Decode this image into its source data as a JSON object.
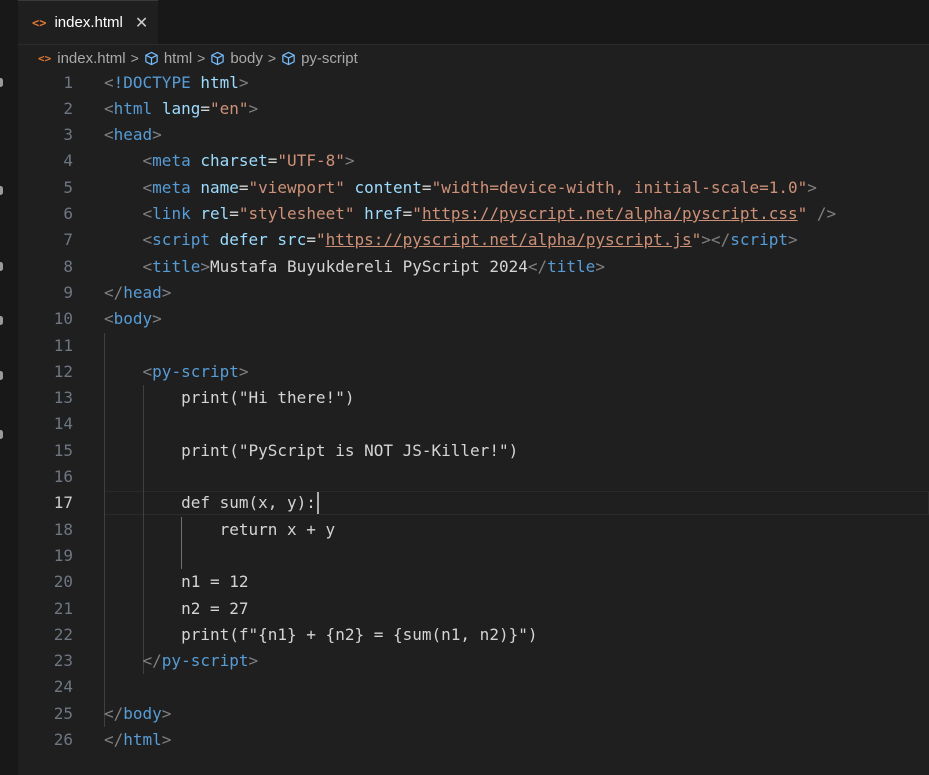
{
  "tab": {
    "icon": "<>",
    "label": "index.html",
    "close": "✕"
  },
  "breadcrumb": {
    "items": [
      {
        "label": "index.html",
        "icon": "html-file-icon"
      },
      {
        "label": "html",
        "icon": "cube-icon"
      },
      {
        "label": "body",
        "icon": "cube-icon"
      },
      {
        "label": "py-script",
        "icon": "cube-icon"
      }
    ],
    "separator": ">"
  },
  "editor": {
    "active_line": 17,
    "lines": [
      {
        "num": "1",
        "tokens": [
          {
            "c": "t-bracket",
            "t": "<"
          },
          {
            "c": "t-tag",
            "t": "!DOCTYPE"
          },
          {
            "c": "t-text",
            "t": " "
          },
          {
            "c": "t-attr",
            "t": "html"
          },
          {
            "c": "t-bracket",
            "t": ">"
          }
        ]
      },
      {
        "num": "2",
        "tokens": [
          {
            "c": "t-bracket",
            "t": "<"
          },
          {
            "c": "t-tag",
            "t": "html"
          },
          {
            "c": "t-text",
            "t": " "
          },
          {
            "c": "t-attr",
            "t": "lang"
          },
          {
            "c": "t-eq",
            "t": "="
          },
          {
            "c": "t-str",
            "t": "\"en\""
          },
          {
            "c": "t-bracket",
            "t": ">"
          }
        ]
      },
      {
        "num": "3",
        "tokens": [
          {
            "c": "t-bracket",
            "t": "<"
          },
          {
            "c": "t-tag",
            "t": "head"
          },
          {
            "c": "t-bracket",
            "t": ">"
          }
        ]
      },
      {
        "num": "4",
        "tokens": [
          {
            "c": "t-text",
            "t": "    "
          },
          {
            "c": "t-bracket",
            "t": "<"
          },
          {
            "c": "t-tag",
            "t": "meta"
          },
          {
            "c": "t-text",
            "t": " "
          },
          {
            "c": "t-attr",
            "t": "charset"
          },
          {
            "c": "t-eq",
            "t": "="
          },
          {
            "c": "t-str",
            "t": "\"UTF-8\""
          },
          {
            "c": "t-bracket",
            "t": ">"
          }
        ]
      },
      {
        "num": "5",
        "tokens": [
          {
            "c": "t-text",
            "t": "    "
          },
          {
            "c": "t-bracket",
            "t": "<"
          },
          {
            "c": "t-tag",
            "t": "meta"
          },
          {
            "c": "t-text",
            "t": " "
          },
          {
            "c": "t-attr",
            "t": "name"
          },
          {
            "c": "t-eq",
            "t": "="
          },
          {
            "c": "t-str",
            "t": "\"viewport\""
          },
          {
            "c": "t-text",
            "t": " "
          },
          {
            "c": "t-attr",
            "t": "content"
          },
          {
            "c": "t-eq",
            "t": "="
          },
          {
            "c": "t-str",
            "t": "\"width=device-width, initial-scale=1.0\""
          },
          {
            "c": "t-bracket",
            "t": ">"
          }
        ]
      },
      {
        "num": "6",
        "tokens": [
          {
            "c": "t-text",
            "t": "    "
          },
          {
            "c": "t-bracket",
            "t": "<"
          },
          {
            "c": "t-tag",
            "t": "link"
          },
          {
            "c": "t-text",
            "t": " "
          },
          {
            "c": "t-attr",
            "t": "rel"
          },
          {
            "c": "t-eq",
            "t": "="
          },
          {
            "c": "t-str",
            "t": "\"stylesheet\""
          },
          {
            "c": "t-text",
            "t": " "
          },
          {
            "c": "t-attr",
            "t": "href"
          },
          {
            "c": "t-eq",
            "t": "="
          },
          {
            "c": "t-str",
            "t": "\""
          },
          {
            "c": "t-link",
            "t": "https://pyscript.net/alpha/pyscript.css"
          },
          {
            "c": "t-str",
            "t": "\""
          },
          {
            "c": "t-text",
            "t": " "
          },
          {
            "c": "t-bracket",
            "t": "/>"
          }
        ]
      },
      {
        "num": "7",
        "tokens": [
          {
            "c": "t-text",
            "t": "    "
          },
          {
            "c": "t-bracket",
            "t": "<"
          },
          {
            "c": "t-tag",
            "t": "script"
          },
          {
            "c": "t-text",
            "t": " "
          },
          {
            "c": "t-attr",
            "t": "defer"
          },
          {
            "c": "t-text",
            "t": " "
          },
          {
            "c": "t-attr",
            "t": "src"
          },
          {
            "c": "t-eq",
            "t": "="
          },
          {
            "c": "t-str",
            "t": "\""
          },
          {
            "c": "t-link",
            "t": "https://pyscript.net/alpha/pyscript.js"
          },
          {
            "c": "t-str",
            "t": "\""
          },
          {
            "c": "t-bracket",
            "t": "></"
          },
          {
            "c": "t-tag",
            "t": "script"
          },
          {
            "c": "t-bracket",
            "t": ">"
          }
        ]
      },
      {
        "num": "8",
        "tokens": [
          {
            "c": "t-text",
            "t": "    "
          },
          {
            "c": "t-bracket",
            "t": "<"
          },
          {
            "c": "t-tag",
            "t": "title"
          },
          {
            "c": "t-bracket",
            "t": ">"
          },
          {
            "c": "t-text",
            "t": "Mustafa Buyukdereli PyScript 2024"
          },
          {
            "c": "t-bracket",
            "t": "</"
          },
          {
            "c": "t-tag",
            "t": "title"
          },
          {
            "c": "t-bracket",
            "t": ">"
          }
        ]
      },
      {
        "num": "9",
        "tokens": [
          {
            "c": "t-bracket",
            "t": "</"
          },
          {
            "c": "t-tag",
            "t": "head"
          },
          {
            "c": "t-bracket",
            "t": ">"
          }
        ]
      },
      {
        "num": "10",
        "tokens": [
          {
            "c": "t-bracket",
            "t": "<"
          },
          {
            "c": "t-tag",
            "t": "body"
          },
          {
            "c": "t-bracket",
            "t": ">"
          }
        ]
      },
      {
        "num": "11",
        "tokens": []
      },
      {
        "num": "12",
        "tokens": [
          {
            "c": "t-text",
            "t": "    "
          },
          {
            "c": "t-bracket",
            "t": "<"
          },
          {
            "c": "t-tag",
            "t": "py-script"
          },
          {
            "c": "t-bracket",
            "t": ">"
          }
        ]
      },
      {
        "num": "13",
        "tokens": [
          {
            "c": "t-text",
            "t": "        print(\"Hi there!\")"
          }
        ]
      },
      {
        "num": "14",
        "tokens": []
      },
      {
        "num": "15",
        "tokens": [
          {
            "c": "t-text",
            "t": "        print(\"PyScript is NOT JS-Killer!\")"
          }
        ]
      },
      {
        "num": "16",
        "tokens": []
      },
      {
        "num": "17",
        "tokens": [
          {
            "c": "t-text",
            "t": "        def sum(x, y):"
          }
        ]
      },
      {
        "num": "18",
        "tokens": [
          {
            "c": "t-text",
            "t": "            return x + y"
          }
        ]
      },
      {
        "num": "19",
        "tokens": []
      },
      {
        "num": "20",
        "tokens": [
          {
            "c": "t-text",
            "t": "        n1 = 12"
          }
        ]
      },
      {
        "num": "21",
        "tokens": [
          {
            "c": "t-text",
            "t": "        n2 = 27"
          }
        ]
      },
      {
        "num": "22",
        "tokens": [
          {
            "c": "t-text",
            "t": "        print(f\"{n1} + {n2} = {sum(n1, n2)}\")"
          }
        ]
      },
      {
        "num": "23",
        "tokens": [
          {
            "c": "t-text",
            "t": "    "
          },
          {
            "c": "t-bracket",
            "t": "</"
          },
          {
            "c": "t-tag",
            "t": "py-script"
          },
          {
            "c": "t-bracket",
            "t": ">"
          }
        ]
      },
      {
        "num": "24",
        "tokens": []
      },
      {
        "num": "25",
        "tokens": [
          {
            "c": "t-bracket",
            "t": "</"
          },
          {
            "c": "t-tag",
            "t": "body"
          },
          {
            "c": "t-bracket",
            "t": ">"
          }
        ]
      },
      {
        "num": "26",
        "tokens": [
          {
            "c": "t-bracket",
            "t": "</"
          },
          {
            "c": "t-tag",
            "t": "html"
          },
          {
            "c": "t-bracket",
            "t": ">"
          }
        ]
      }
    ]
  }
}
